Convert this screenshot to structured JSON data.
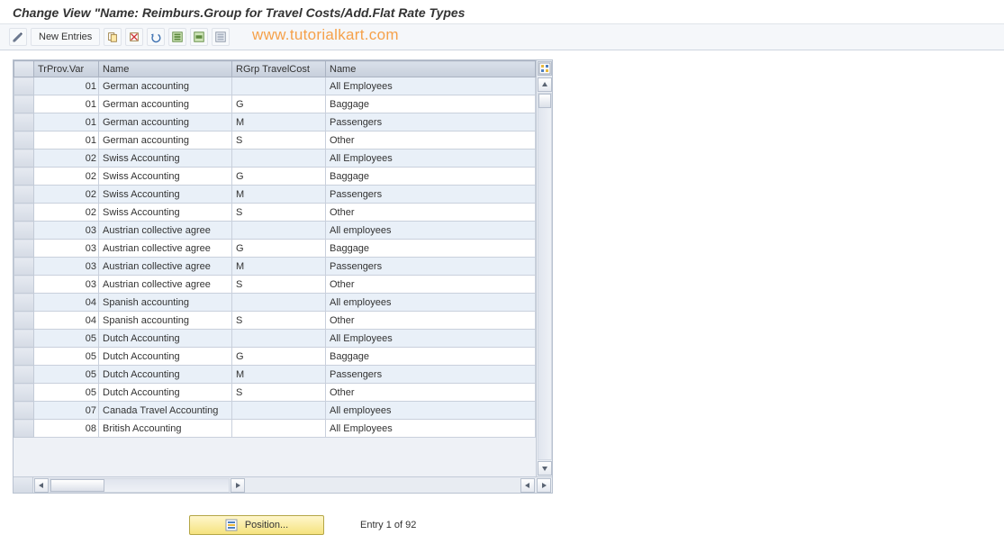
{
  "title": "Change View \"Name: Reimburs.Group for Travel Costs/Add.Flat Rate Types",
  "watermark": "www.tutorialkart.com",
  "toolbar": {
    "new_entries_label": "New Entries"
  },
  "grid": {
    "columns": [
      "TrProv.Var",
      "Name",
      "RGrp TravelCost",
      "Name"
    ],
    "rows": [
      {
        "var": "01",
        "name1": "German accounting",
        "rgrp": "",
        "name2": "All Employees"
      },
      {
        "var": "01",
        "name1": "German accounting",
        "rgrp": "G",
        "name2": "Baggage"
      },
      {
        "var": "01",
        "name1": "German accounting",
        "rgrp": "M",
        "name2": "Passengers"
      },
      {
        "var": "01",
        "name1": "German accounting",
        "rgrp": "S",
        "name2": "Other"
      },
      {
        "var": "02",
        "name1": "Swiss Accounting",
        "rgrp": "",
        "name2": "All Employees"
      },
      {
        "var": "02",
        "name1": "Swiss Accounting",
        "rgrp": "G",
        "name2": "Baggage"
      },
      {
        "var": "02",
        "name1": "Swiss Accounting",
        "rgrp": "M",
        "name2": "Passengers"
      },
      {
        "var": "02",
        "name1": "Swiss Accounting",
        "rgrp": "S",
        "name2": "Other"
      },
      {
        "var": "03",
        "name1": "Austrian collective agree",
        "rgrp": "",
        "name2": "All employees"
      },
      {
        "var": "03",
        "name1": "Austrian collective agree",
        "rgrp": "G",
        "name2": "Baggage"
      },
      {
        "var": "03",
        "name1": "Austrian collective agree",
        "rgrp": "M",
        "name2": "Passengers"
      },
      {
        "var": "03",
        "name1": "Austrian collective agree",
        "rgrp": "S",
        "name2": "Other"
      },
      {
        "var": "04",
        "name1": "Spanish accounting",
        "rgrp": "",
        "name2": "All employees"
      },
      {
        "var": "04",
        "name1": "Spanish accounting",
        "rgrp": "S",
        "name2": "Other"
      },
      {
        "var": "05",
        "name1": "Dutch Accounting",
        "rgrp": "",
        "name2": "All Employees"
      },
      {
        "var": "05",
        "name1": "Dutch Accounting",
        "rgrp": "G",
        "name2": "Baggage"
      },
      {
        "var": "05",
        "name1": "Dutch Accounting",
        "rgrp": "M",
        "name2": "Passengers"
      },
      {
        "var": "05",
        "name1": "Dutch Accounting",
        "rgrp": "S",
        "name2": "Other"
      },
      {
        "var": "07",
        "name1": "Canada Travel Accounting",
        "rgrp": "",
        "name2": "All employees"
      },
      {
        "var": "08",
        "name1": "British Accounting",
        "rgrp": "",
        "name2": "All Employees"
      }
    ]
  },
  "footer": {
    "position_label": "Position...",
    "entry_label": "Entry 1 of 92"
  }
}
